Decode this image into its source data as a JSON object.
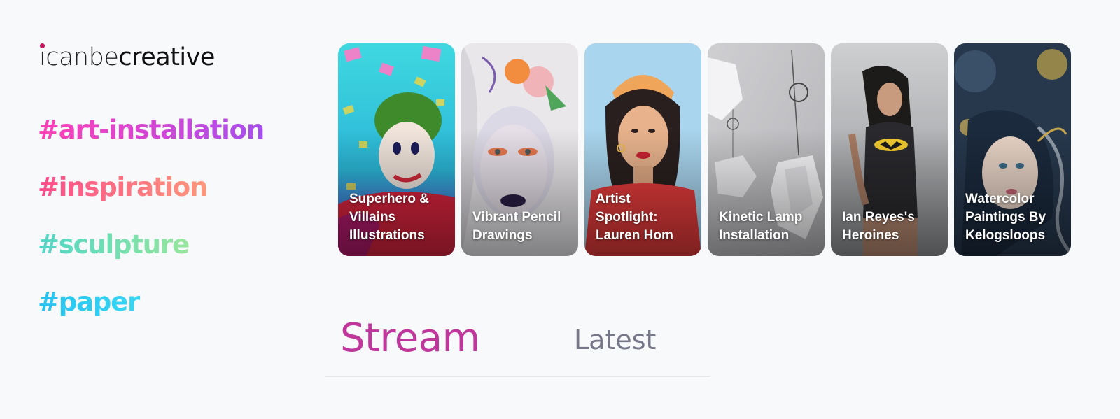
{
  "logo": {
    "light": "icanbe",
    "bold": "creative"
  },
  "tags": [
    {
      "label": "#art-installation"
    },
    {
      "label": "#inspiration"
    },
    {
      "label": "#sculpture"
    },
    {
      "label": "#paper"
    }
  ],
  "cards": [
    {
      "caption": "Superhero & Villains Illustrations"
    },
    {
      "caption": "Vibrant Pencil Drawings"
    },
    {
      "caption": "Artist Spotlight: Lauren Hom"
    },
    {
      "caption": "Kinetic Lamp Installation"
    },
    {
      "caption": "Ian Reyes's Heroines"
    },
    {
      "caption": "Watercolor Paintings By Kelogsloops"
    }
  ],
  "tabs": {
    "stream": "Stream",
    "latest": "Latest"
  },
  "colors": {
    "background": "#f8f9fb",
    "stream_accent": "#c0379b",
    "latest_inactive": "#77778a"
  }
}
